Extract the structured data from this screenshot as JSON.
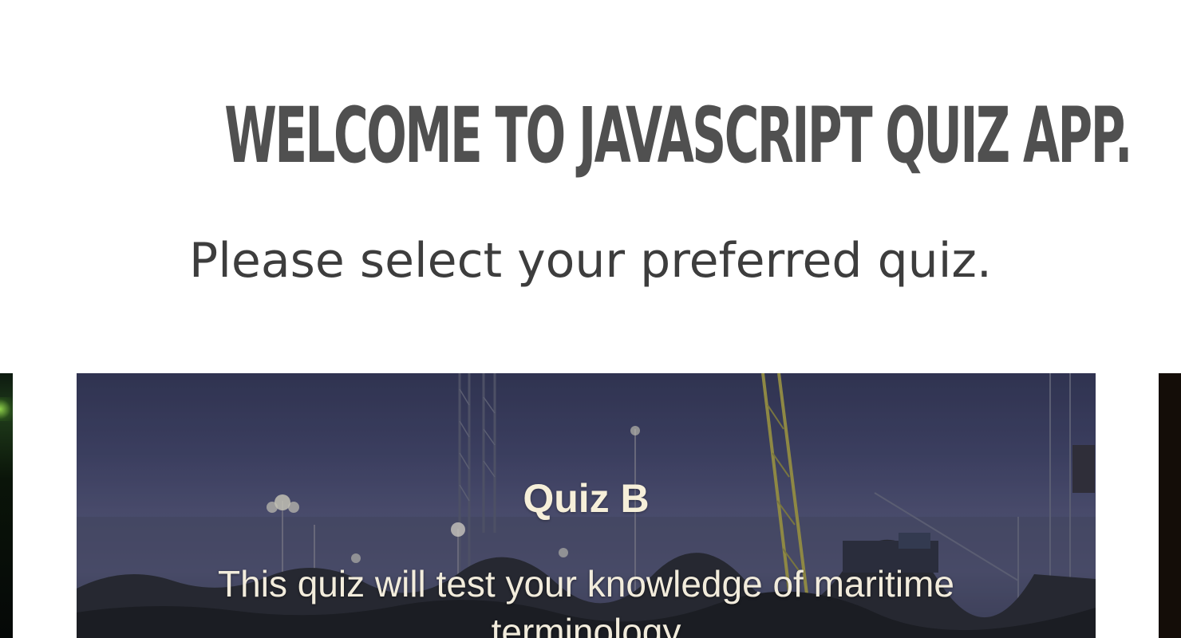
{
  "header": {
    "title": "WELCOME TO JAVASCRIPT QUIZ APP.",
    "subtitle": "Please select your preferred quiz."
  },
  "carousel": {
    "active_card": {
      "title": "Quiz B",
      "description": "This quiz will test your knowledge of maritime terminology"
    }
  },
  "colors": {
    "title_text": "#505050",
    "subtitle_text": "#3d3d3d",
    "card_text": "#f6efd9",
    "card_sky": "#43476a"
  }
}
